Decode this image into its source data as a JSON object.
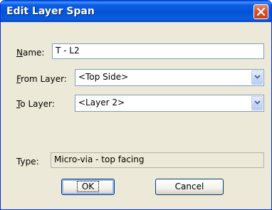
{
  "window": {
    "title": "Edit Layer Span"
  },
  "form": {
    "name": {
      "label_key": "N",
      "label_rest": "ame:",
      "value": "T - L2"
    },
    "from_layer": {
      "label_key": "F",
      "label_rest": "rom Layer:",
      "value": "<Top Side>"
    },
    "to_layer": {
      "label_key": "T",
      "label_rest": "o Layer:",
      "value": "<Layer 2>"
    },
    "type": {
      "label": "Type:",
      "value": "Micro-via - top facing"
    }
  },
  "buttons": {
    "ok": "OK",
    "cancel": "Cancel"
  },
  "icons": {
    "close": "close-icon",
    "dropdown": "chevron-down-icon"
  },
  "colors": {
    "titlebar": "#0553d6",
    "dialog_bg": "#ece9d8",
    "close": "#d7502b"
  }
}
